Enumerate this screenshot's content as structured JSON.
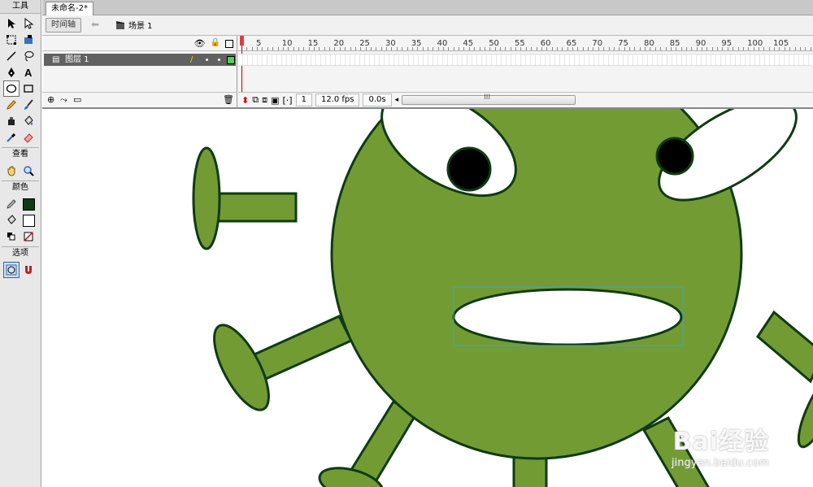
{
  "toolbox": {
    "title": "工具",
    "view_label": "查看",
    "color_label": "颜色",
    "options_label": "选项"
  },
  "document": {
    "tab_title": "未命名-2*"
  },
  "breadcrumb": {
    "timeline_button": "时间轴",
    "scene_label": "场景 1"
  },
  "timeline": {
    "layer_name": "图层 1",
    "ruler_numbers": [
      "5",
      "10",
      "15",
      "20",
      "25",
      "30",
      "35",
      "40",
      "45",
      "50",
      "55",
      "60",
      "65",
      "70",
      "75",
      "80",
      "85",
      "90",
      "95",
      "100",
      "105"
    ],
    "current_frame": "1",
    "frame_rate": "12.0 fps",
    "elapsed_time": "0.0s",
    "scroll_thumb": "III"
  },
  "colors": {
    "virus_fill": "#739b34",
    "virus_stroke": "#0f3b12",
    "selection": "#3fa7b3",
    "stroke_swatch": "#0f3b12",
    "fill_swatch": "#ffffff"
  },
  "watermark": {
    "logo": "Bai经验",
    "url": "jingyan.baidu.com"
  }
}
